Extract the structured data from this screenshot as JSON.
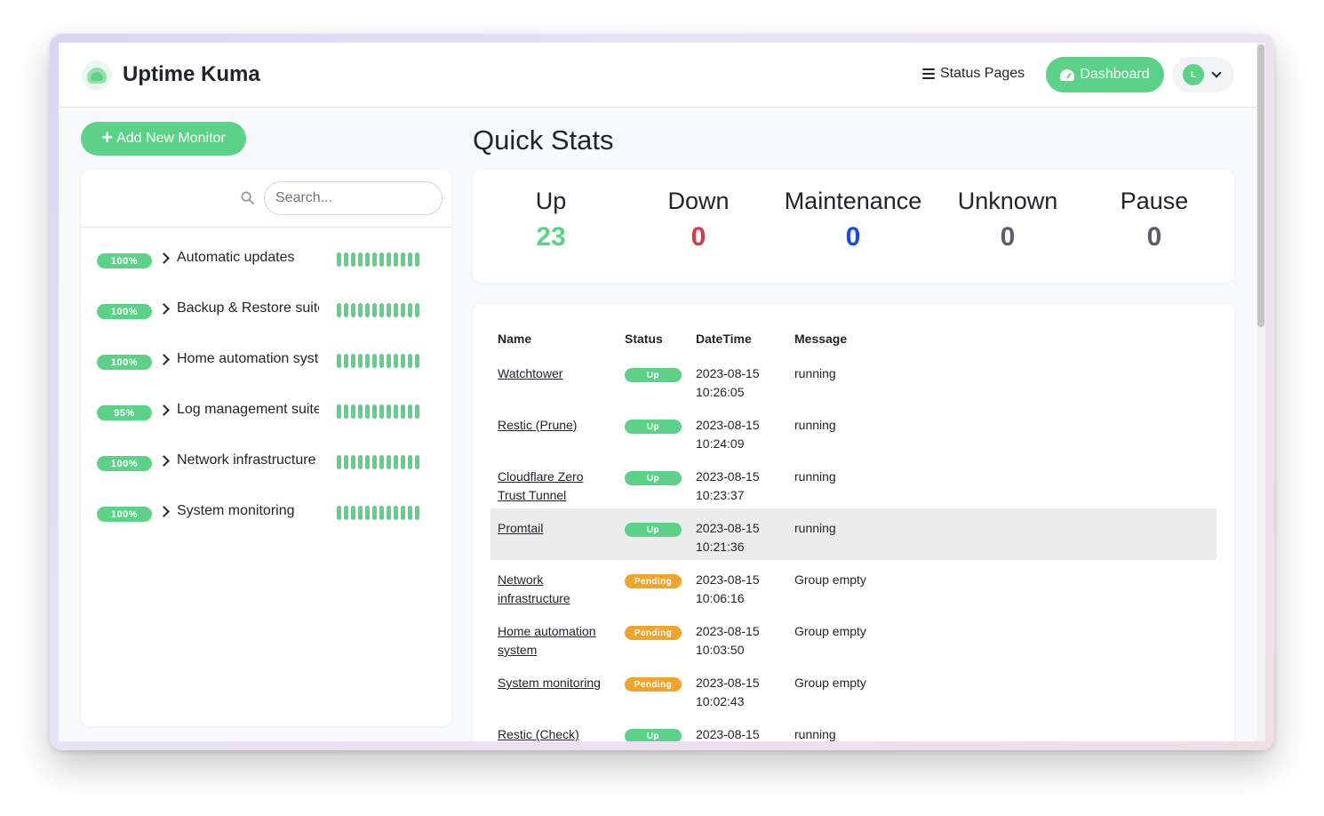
{
  "header": {
    "brand": "Uptime Kuma",
    "status_pages_label": "Status Pages",
    "dashboard_label": "Dashboard",
    "avatar_letter": "L",
    "accent_color": "#5cd188"
  },
  "sidebar": {
    "add_button_label": "Add New Monitor",
    "search_placeholder": "Search...",
    "monitors": [
      {
        "uptime": "100%",
        "name": "Automatic updates"
      },
      {
        "uptime": "100%",
        "name": "Backup & Restore suite"
      },
      {
        "uptime": "100%",
        "name": "Home automation system"
      },
      {
        "uptime": "95%",
        "name": "Log management suite"
      },
      {
        "uptime": "100%",
        "name": "Network infrastructure"
      },
      {
        "uptime": "100%",
        "name": "System monitoring"
      }
    ]
  },
  "quick_stats": {
    "title": "Quick Stats",
    "items": [
      {
        "label": "Up",
        "value": "23",
        "color": "#5cd188"
      },
      {
        "label": "Down",
        "value": "0",
        "color": "#dc3545"
      },
      {
        "label": "Maintenance",
        "value": "0",
        "color": "#1747f5"
      },
      {
        "label": "Unknown",
        "value": "0",
        "color": "#5c5f66"
      },
      {
        "label": "Pause",
        "value": "0",
        "color": "#5c5f66"
      }
    ]
  },
  "events": {
    "columns": {
      "name": "Name",
      "status": "Status",
      "datetime": "DateTime",
      "message": "Message"
    },
    "rows": [
      {
        "name": "Watchtower",
        "status": "Up",
        "date": "2023-08-15",
        "time": "10:26:05",
        "message": "running"
      },
      {
        "name": "Restic (Prune)",
        "status": "Up",
        "date": "2023-08-15",
        "time": "10:24:09",
        "message": "running"
      },
      {
        "name": "Cloudflare Zero Trust Tunnel",
        "status": "Up",
        "date": "2023-08-15",
        "time": "10:23:37",
        "message": "running"
      },
      {
        "name": "Promtail",
        "status": "Up",
        "date": "2023-08-15",
        "time": "10:21:36",
        "message": "running"
      },
      {
        "name": "Network infrastructure",
        "status": "Pending",
        "date": "2023-08-15",
        "time": "10:06:16",
        "message": "Group empty"
      },
      {
        "name": "Home automation system",
        "status": "Pending",
        "date": "2023-08-15",
        "time": "10:03:50",
        "message": "Group empty"
      },
      {
        "name": "System monitoring",
        "status": "Pending",
        "date": "2023-08-15",
        "time": "10:02:43",
        "message": "Group empty"
      },
      {
        "name": "Restic (Check)",
        "status": "Up",
        "date": "2023-08-15",
        "time": "",
        "message": "running"
      }
    ]
  }
}
